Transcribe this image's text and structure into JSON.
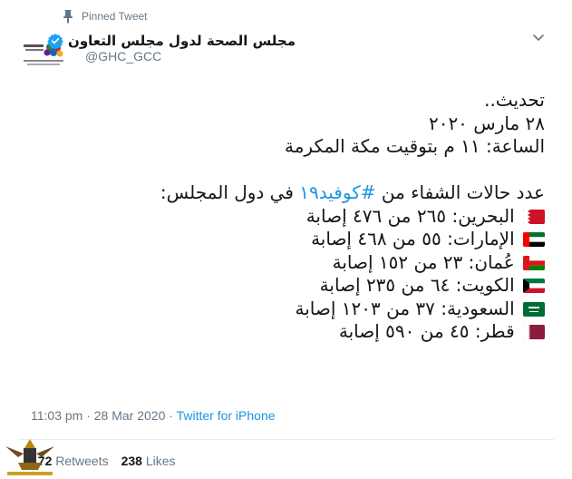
{
  "pinned": {
    "label": "Pinned Tweet"
  },
  "user": {
    "display_name": "مجلس الصحة لدول مجلس التعاون",
    "handle": "@GHC_GCC"
  },
  "tweet": {
    "lines": [
      "تحديث..",
      "٢٨ مارس ٢٠٢٠",
      "الساعة: ١١ م بتوقيت مكة المكرمة"
    ],
    "intro_before": "عدد حالات الشفاء من",
    "hashtag": "#كوفيد١٩",
    "intro_after": "في دول المجلس:",
    "countries": [
      {
        "text": "البحرين: ٢٦٥ من ٤٧٦ إصابة",
        "flag": "bahrain"
      },
      {
        "text": "الإمارات: ٥٥ من ٤٦٨ إصابة",
        "flag": "uae"
      },
      {
        "text": "عُمان: ٢٣ من ١٥٢ إصابة",
        "flag": "oman"
      },
      {
        "text": "الكويت: ٦٤ من ٢٣٥ إصابة",
        "flag": "kuwait"
      },
      {
        "text": "السعودية: ٣٧ من ١٢٠٣ إصابة",
        "flag": "saudi"
      },
      {
        "text": "قطر: ٤٥ من ٥٩٠ إصابة",
        "flag": "qatar"
      }
    ]
  },
  "meta": {
    "timestamp": "11:03 pm · 28 Mar 2020 · ",
    "source": "Twitter for iPhone"
  },
  "stats": {
    "retweets_count": "172",
    "retweets_label": "Retweets",
    "likes_count": "238",
    "likes_label": "Likes"
  },
  "colors": {
    "link": "#1b95e0",
    "muted": "#657786",
    "text": "#14171a"
  }
}
